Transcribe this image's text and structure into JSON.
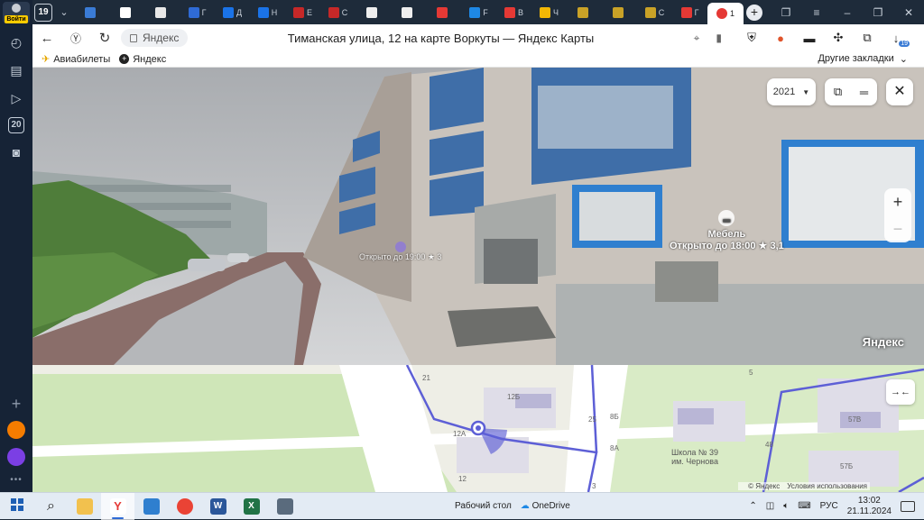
{
  "sidebar": {
    "login_label": "Войти",
    "tabs_count_label": "20"
  },
  "tabstrip": {
    "tab_count": "19",
    "tabs": [
      {
        "text": "",
        "color": "#3a7bd5"
      },
      {
        "text": "",
        "color": "#ffffff"
      },
      {
        "text": "",
        "color": "#e8e8e8"
      },
      {
        "text": "Г",
        "color": "#2f6bd6"
      },
      {
        "text": "Д",
        "color": "#1a73e8"
      },
      {
        "text": "Н",
        "color": "#1a73e8"
      },
      {
        "text": "Е",
        "color": "#c62828"
      },
      {
        "text": "С",
        "color": "#c62828"
      },
      {
        "text": "",
        "color": "#eeeeee"
      },
      {
        "text": "",
        "color": "#eeeeee"
      },
      {
        "text": "",
        "color": "#e53935"
      },
      {
        "text": "F",
        "color": "#1e88e5"
      },
      {
        "text": "В",
        "color": "#e53935"
      },
      {
        "text": "Ч",
        "color": "#f2b705"
      },
      {
        "text": "",
        "color": "#c9a227"
      },
      {
        "text": "",
        "color": "#c9a227"
      },
      {
        "text": "С",
        "color": "#c9a227"
      },
      {
        "text": "Г",
        "color": "#e53935"
      }
    ],
    "active_tab": {
      "text": "1",
      "color": "#e53935"
    }
  },
  "toolbar": {
    "site_name": "Яндекс",
    "page_title": "Тиманская улица, 12 на карте Воркуты — Яндекс Карты",
    "download_badge": "19"
  },
  "bookmarks": {
    "items": [
      {
        "label": "Авиабилеты"
      },
      {
        "label": "Яндекс"
      }
    ],
    "other_label": "Другие закладки"
  },
  "panorama": {
    "year": "2021",
    "poi_main": {
      "name": "Мебель",
      "hours": "Открыто до 18:00",
      "rating": "★ 3,1"
    },
    "poi_small_hours": "Открыто до 19:00 ★ 3",
    "logo": "Яндекс"
  },
  "map": {
    "labels": [
      "21",
      "12Б",
      "12А",
      "12",
      "8Б",
      "8А",
      "5",
      "48",
      "57Б",
      "57В",
      "25",
      "3"
    ],
    "school_name": "Школа № 39",
    "school_sub": "им. Чернова",
    "copyright": "© Яндекс",
    "terms": "Условия использования"
  },
  "taskbar": {
    "desktop_label": "Рабочий стол",
    "onedrive_label": "OneDrive",
    "language": "РУС",
    "time": "13:02",
    "date": "21.11.2024"
  }
}
